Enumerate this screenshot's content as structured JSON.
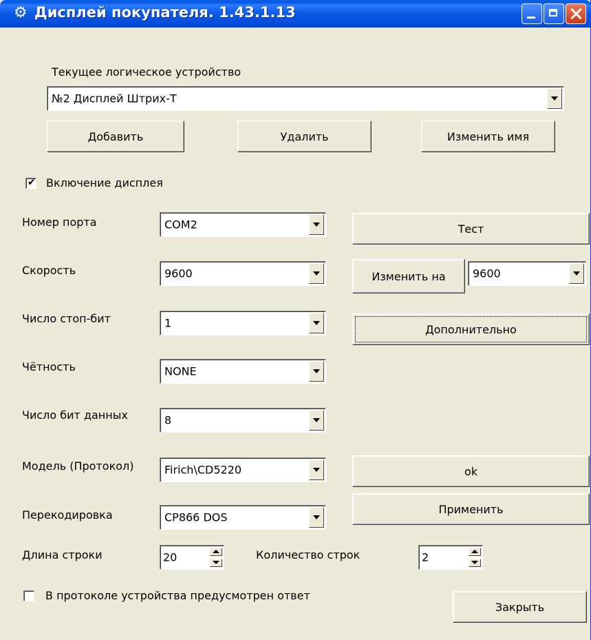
{
  "window": {
    "title": "Дисплей покупателя. 1.43.1.13",
    "icon": "gear-icon"
  },
  "device": {
    "label": "Текущее логическое устройство",
    "selected": "№2 Дисплей Штрих-Т",
    "add_label": "Добавить",
    "delete_label": "Удалить",
    "rename_label": "Изменить имя"
  },
  "enable_display": {
    "label": "Включение дисплея",
    "checked": true,
    "mark": "✔"
  },
  "port": {
    "label": "Номер порта",
    "value": "COM2"
  },
  "speed": {
    "label": "Скорость",
    "value": "9600"
  },
  "stop_bits": {
    "label": "Число стоп-бит",
    "value": "1"
  },
  "parity": {
    "label": "Чётность",
    "value": "NONE"
  },
  "data_bits": {
    "label": "Число бит данных",
    "value": "8"
  },
  "model": {
    "label": "Модель (Протокол)",
    "value": "Firich\\CD5220"
  },
  "recode": {
    "label": "Перекодировка",
    "value": "CP866 DOS"
  },
  "line_length": {
    "label": "Длина строки",
    "value": "20"
  },
  "line_count": {
    "label": "Количество строк",
    "value": "2"
  },
  "response": {
    "label": "В протоколе устройства предусмотрен ответ",
    "checked": false,
    "mark": ""
  },
  "buttons": {
    "test": "Тест",
    "change_to": "Изменить на",
    "change_speed_value": "9600",
    "advanced": "Дополнительно",
    "ok": "ok",
    "apply": "Применить",
    "close": "Закрыть"
  }
}
